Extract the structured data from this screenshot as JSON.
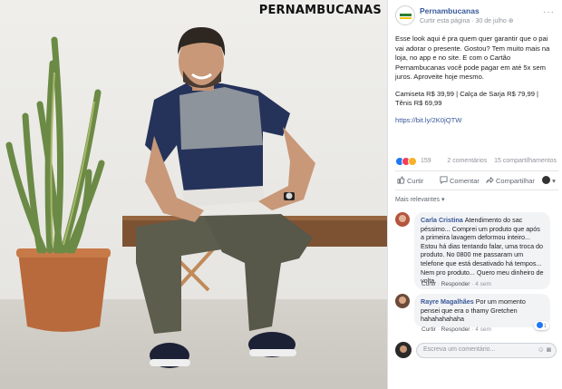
{
  "photo": {
    "brand_overlay": "PERNAMBUCANAS"
  },
  "post": {
    "page_name": "Pernambucanas",
    "meta_like_page": "Curtir esta página",
    "meta_date": "30 de julho",
    "paragraph1": "Esse look aqui é pra quem quer garantir que o pai vai adorar o presente. Gostou? Tem muito mais na loja, no app e no site. E com o Cartão Pernambucanas você pode pagar em até 5x sem juros. Aproveite hoje mesmo.",
    "paragraph2": "Camiseta R$ 39,99 | Calça de Sarja R$ 79,99 | Tênis R$ 69,99",
    "link": "https://bit.ly/2K0jQTW",
    "reaction_count": "159",
    "comments_count": "2 comentários",
    "shares_count": "15 compartilhamentos",
    "like_label": "Curtir",
    "comment_label": "Comentar",
    "share_label": "Compartilhar",
    "sort_label": "Mais relevantes"
  },
  "comments": [
    {
      "author": "Carla Cristina",
      "text": "Atendimento do sac péssimo... Comprei um produto que após a primeira lavagem deformou inteiro... Estou há dias tentando falar, uma troca do produto. No 0800 me passaram um telefone que está desativado há tempos... Nem pro produto... Quero meu dinheiro de volta.",
      "like_label": "Curtir",
      "reply_label": "Responder",
      "time": "4 sem"
    },
    {
      "author": "Rayre Magalhães",
      "text": "Por um momento pensei que era o thamy Gretchen hahahahahaha",
      "like_label": "Curtir",
      "reply_label": "Responder",
      "time": "4 sem",
      "likes": "1"
    }
  ],
  "composer": {
    "placeholder": "Escreva um comentário..."
  },
  "colors": {
    "link": "#365899",
    "like_blue": "#2078f4",
    "brand_green": "#2e7d32"
  }
}
